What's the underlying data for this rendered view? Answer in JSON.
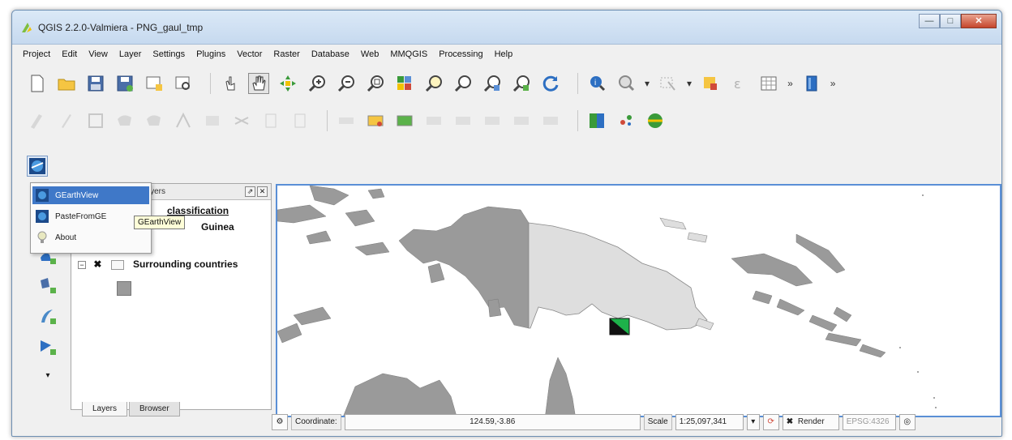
{
  "window": {
    "title": "QGIS 2.2.0-Valmiera - PNG_gaul_tmp",
    "controls": [
      "—",
      "□",
      "✕"
    ]
  },
  "menubar": [
    "Project",
    "Edit",
    "View",
    "Layer",
    "Settings",
    "Plugins",
    "Vector",
    "Raster",
    "Database",
    "Web",
    "MMQGIS",
    "Processing",
    "Help"
  ],
  "toolbar_icons": {
    "row1": [
      "new-project-icon",
      "open-folder-icon",
      "save-icon",
      "save-as-icon",
      "new-print-composer-icon",
      "composer-manager-icon",
      "touch-icon",
      "pan-hand-icon",
      "pan-to-selection-icon",
      "zoom-in-icon",
      "zoom-out-icon",
      "zoom-full-icon",
      "zoom-to-layer-icon",
      "zoom-last-icon",
      "zoom-next-icon",
      "zoom-native-icon",
      "refresh-icon",
      "identify-icon",
      "measure-icon",
      "select-icon",
      "deselect-icon",
      "field-calculator-icon",
      "attribute-table-icon",
      "more-icon",
      "help-icon",
      "more-icon"
    ],
    "row2": [
      "current-edits-icon",
      "toggle-editing-icon",
      "save-edits-icon",
      "add-feature-icon",
      "move-feature-icon",
      "node-tool-icon",
      "delete-selected-icon",
      "cut-icon",
      "copy-icon",
      "paste-icon",
      "label-icon",
      "pin-label-icon",
      "show-hide-label-icon",
      "move-label-icon",
      "rotate-label-icon",
      "change-label-icon",
      "label-config-icon",
      "python-console-icon",
      "globe-icon",
      "gearthview-small-icon"
    ],
    "row3": [
      "gearthview-plugin-icon"
    ]
  },
  "plugin_menu": {
    "items": [
      {
        "label": "GEarthView",
        "icon": "gearthview-icon",
        "highlighted": true
      },
      {
        "label": "PasteFromGE",
        "icon": "paste-from-ge-icon",
        "highlighted": false
      },
      {
        "label": "About",
        "icon": "info-bulb-icon",
        "highlighted": false
      }
    ],
    "tooltip": "GEarthView"
  },
  "layers_panel": {
    "title": "Layers",
    "header_buttons": [
      "⇗",
      "✕"
    ],
    "layer_partial_1": "classification",
    "layer_partial_2": "Guinea",
    "layer_surrounding": "Surrounding countries",
    "tabs": [
      "Layers",
      "Browser"
    ]
  },
  "left_tools": [
    "add-vector-layer-icon",
    "add-raster-layer-icon",
    "add-postgis-layer-icon",
    "add-wms-layer-icon",
    "add-delimited-text-icon",
    "expand-more-icon"
  ],
  "statusbar": {
    "coordinate_label": "Coordinate:",
    "coordinate_value": "124.59,-3.86",
    "scale_label": "Scale",
    "scale_value": "1:25,097,341",
    "render_label": "Render",
    "render_checked": "✖",
    "crs": "EPSG:4326"
  },
  "colors": {
    "highlight": "#3f78c8",
    "png_land": "#dedede",
    "surrounding_land": "#9a9a9a",
    "marker_green": "#1db24a"
  }
}
